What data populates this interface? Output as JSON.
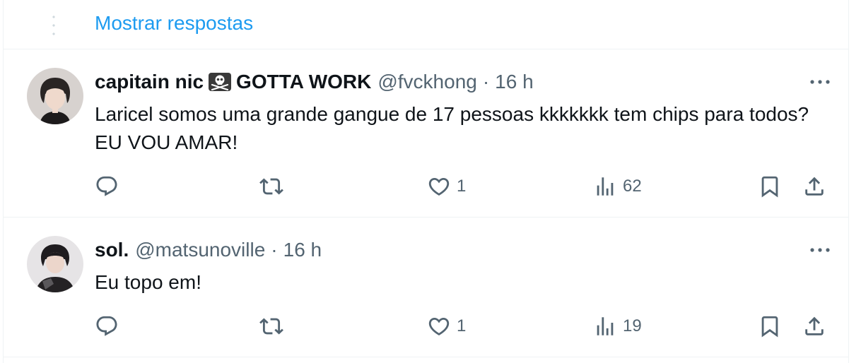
{
  "thread": {
    "show_replies_label": "Mostrar respostas"
  },
  "tweets": [
    {
      "display_name": "capitain nic",
      "badge_icon": "skull-crossbones-icon",
      "display_name_suffix": "GOTTA WORK",
      "handle": "@fvckhong",
      "separator": "·",
      "time": "16 h",
      "text": "Laricel somos uma grande gangue de 17 pessoas kkkkkkk tem chips para todos? EU VOU AMAR!",
      "replies": "",
      "retweets": "",
      "likes": "1",
      "views": "62"
    },
    {
      "display_name": "sol.",
      "handle": "@matsunoville",
      "separator": "·",
      "time": "16 h",
      "text": "Eu topo em!",
      "replies": "",
      "retweets": "",
      "likes": "1",
      "views": "19"
    }
  ],
  "icons": {
    "reply": "reply-icon",
    "retweet": "retweet-icon",
    "like": "heart-icon",
    "views": "views-icon",
    "bookmark": "bookmark-icon",
    "share": "share-icon",
    "more": "more-icon"
  },
  "colors": {
    "accent": "#1d9bf0",
    "text": "#0f1419",
    "secondary": "#536471",
    "border": "#eff3f4"
  }
}
